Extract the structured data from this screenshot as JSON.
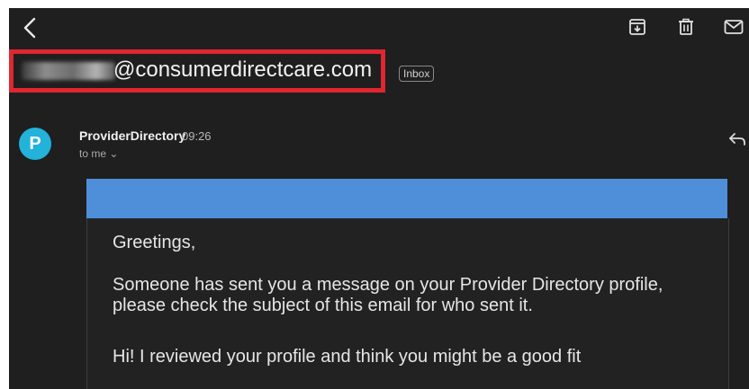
{
  "toolbar": {
    "back_icon": "chevron-left-icon",
    "archive_icon": "archive-icon",
    "delete_icon": "trash-icon",
    "mark_unread_icon": "mail-icon"
  },
  "subject": {
    "text": "@consumerdirectcare.com",
    "label": "Inbox",
    "highlight_color": "#e0262f"
  },
  "sender": {
    "avatar_letter": "P",
    "avatar_color": "#23b2d9",
    "name": "ProviderDirectory",
    "time": "09:26",
    "recipient": "to me ⌄"
  },
  "message": {
    "banner_color": "#4f8fd9",
    "greeting": "Greetings,",
    "paragraph1": "Someone has sent you a message on your Provider Directory profile, please check the subject of this email for who sent it.",
    "paragraph2": "Hi! I reviewed your profile and think you might be a good fit"
  }
}
